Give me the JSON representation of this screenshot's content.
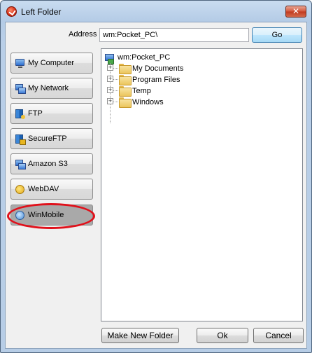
{
  "window": {
    "title": "Left Folder",
    "close_glyph": "✕"
  },
  "address": {
    "label": "Address",
    "value": "wm:Pocket_PC\\",
    "go_label": "Go"
  },
  "nav": [
    {
      "label": "My Computer",
      "icon": "my-computer-icon",
      "selected": false
    },
    {
      "label": "My Network",
      "icon": "my-network-icon",
      "selected": false
    },
    {
      "label": "FTP",
      "icon": "ftp-icon",
      "selected": false
    },
    {
      "label": "SecureFTP",
      "icon": "secureftp-icon",
      "selected": false
    },
    {
      "label": "Amazon S3",
      "icon": "amazon-s3-icon",
      "selected": false
    },
    {
      "label": "WebDAV",
      "icon": "webdav-icon",
      "selected": false
    },
    {
      "label": "WinMobile",
      "icon": "winmobile-icon",
      "selected": true
    }
  ],
  "tree": {
    "root": "wm:Pocket_PC",
    "children": [
      {
        "label": "My Documents",
        "expander": "+"
      },
      {
        "label": "Program Files",
        "expander": "+"
      },
      {
        "label": "Temp",
        "expander": "+"
      },
      {
        "label": "Windows",
        "expander": "+"
      }
    ]
  },
  "footer": {
    "new_folder": "Make New Folder",
    "ok": "Ok",
    "cancel": "Cancel"
  },
  "colors": {
    "highlight": "#e0111b",
    "selected_nav": "#a9a9a9"
  }
}
